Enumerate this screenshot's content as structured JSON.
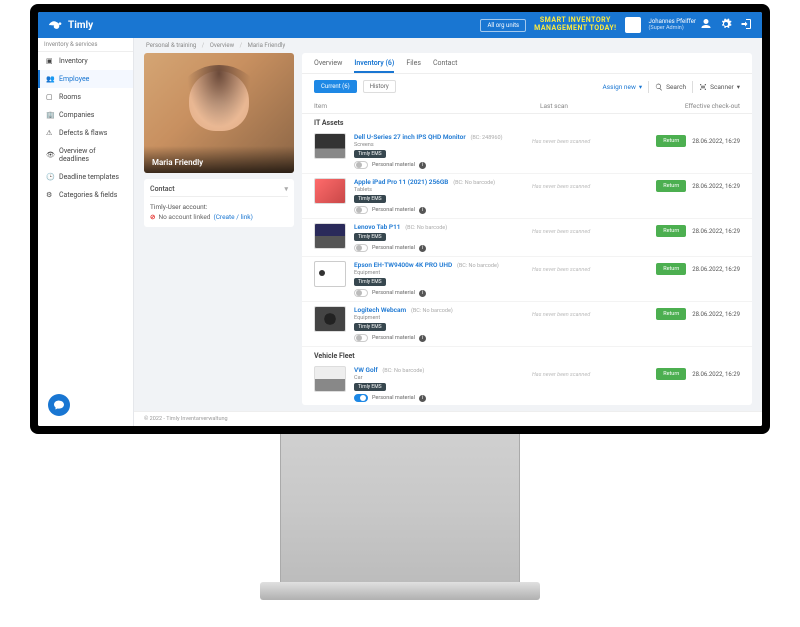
{
  "brand": "Timly",
  "top": {
    "org_button": "All org units",
    "promo_line1": "Smart Inventory",
    "promo_line2": "Management Today!",
    "user_name": "Johannes Pfeiffer",
    "user_role": "(Super Admin)"
  },
  "sidebar": {
    "header": "Inventory & services",
    "items": [
      {
        "label": "Inventory"
      },
      {
        "label": "Employee"
      },
      {
        "label": "Rooms"
      },
      {
        "label": "Companies"
      },
      {
        "label": "Defects & flaws"
      },
      {
        "label": "Overview of deadlines"
      },
      {
        "label": "Deadline templates"
      },
      {
        "label": "Categories & fields"
      }
    ]
  },
  "crumbs": {
    "a": "Personal & training",
    "b": "Overview",
    "c": "Maria Friendly"
  },
  "profile": {
    "name": "Maria Friendly",
    "contact_heading": "Contact",
    "account_label": "Timly-User account:",
    "no_account": "No account linked",
    "create_link": "(Create / link)"
  },
  "tabs": {
    "overview": "Overview",
    "inventory": "Inventory (6)",
    "files": "Files",
    "contact": "Contact"
  },
  "toolbar": {
    "current": "Current (6)",
    "history": "History",
    "assign_new": "Assign new",
    "search": "Search",
    "scanner": "Scanner"
  },
  "table_head": {
    "item": "Item",
    "last_scan": "Last scan",
    "effective": "Effective check-out"
  },
  "groups": {
    "it": "IT Assets",
    "fleet": "Vehicle Fleet"
  },
  "common": {
    "return": "Return",
    "personal": "Personal material",
    "never_scanned": "Has never been scanned",
    "tag": "Timly EMS"
  },
  "items_it": [
    {
      "title": "Dell U-Series 27 inch IPS QHD Monitor",
      "bc": "(BC: 248960)",
      "cat": "Screens",
      "date": "28.06.2022, 16:29",
      "thumb": "monitor",
      "toggle": false
    },
    {
      "title": "Apple iPad Pro 11 (2021) 256GB",
      "bc": "(BC: No barcode)",
      "cat": "Tablets",
      "date": "28.06.2022, 16:29",
      "thumb": "ipad",
      "toggle": false
    },
    {
      "title": "Lenovo Tab P11",
      "bc": "(BC: No barcode)",
      "cat": "",
      "date": "28.06.2022, 16:29",
      "thumb": "laptop",
      "toggle": false
    },
    {
      "title": "Epson EH-TW9400w 4K PRO UHD",
      "bc": "(BC: No barcode)",
      "cat": "Equipment",
      "date": "28.06.2022, 16:29",
      "thumb": "projector",
      "toggle": false
    },
    {
      "title": "Logitech Webcam",
      "bc": "(BC: No barcode)",
      "cat": "Equipment",
      "date": "28.06.2022, 16:29",
      "thumb": "webcam",
      "toggle": false
    }
  ],
  "items_fleet": [
    {
      "title": "VW Golf",
      "bc": "(BC: No barcode)",
      "cat": "Car",
      "date": "28.06.2022, 16:29",
      "thumb": "car",
      "toggle": true
    }
  ],
  "footer": "© 2022 - Timly Inventarverwaltung"
}
